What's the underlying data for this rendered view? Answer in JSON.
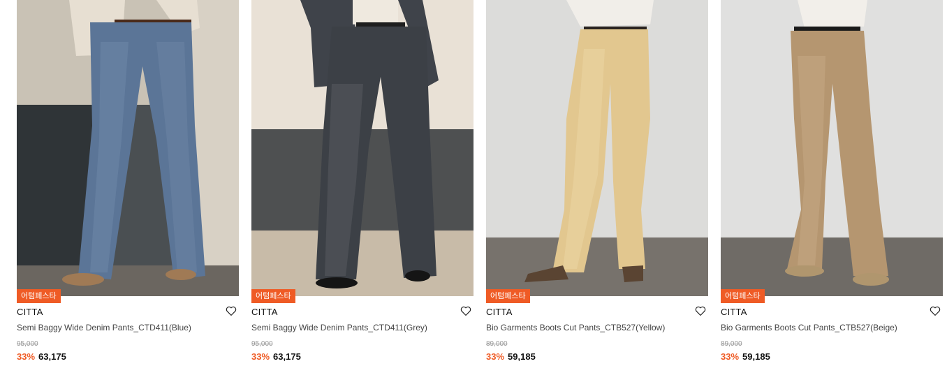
{
  "products": [
    {
      "badge": "어텀페스타",
      "brand": "CITTA",
      "name": "Semi Baggy Wide Denim Pants_CTD411(Blue)",
      "original_price": "95,000",
      "discount": "33%",
      "sale_price": "63,175",
      "image": "blue-denim-wide-pants-photo"
    },
    {
      "badge": "어텀페스타",
      "brand": "CITTA",
      "name": "Semi Baggy Wide Denim Pants_CTD411(Grey)",
      "original_price": "95,000",
      "discount": "33%",
      "sale_price": "63,175",
      "image": "grey-denim-wide-pants-photo"
    },
    {
      "badge": "어텀페스타",
      "brand": "CITTA",
      "name": "Bio Garments Boots Cut Pants_CTB527(Yellow)",
      "original_price": "89,000",
      "discount": "33%",
      "sale_price": "59,185",
      "image": "yellow-bootcut-pants-photo"
    },
    {
      "badge": "어텀페스타",
      "brand": "CITTA",
      "name": "Bio Garments Boots Cut Pants_CTB527(Beige)",
      "original_price": "89,000",
      "discount": "33%",
      "sale_price": "59,185",
      "image": "beige-bootcut-pants-photo"
    }
  ],
  "icons": {
    "wishlist": "heart-outline-icon"
  },
  "colors": {
    "accent": "#ef5b25",
    "text": "#111111",
    "muted": "#9a9a9a"
  }
}
